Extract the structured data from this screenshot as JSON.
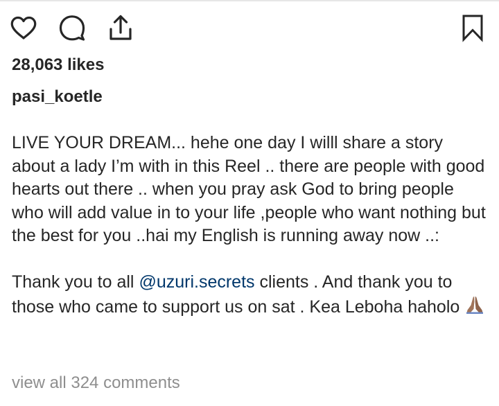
{
  "post": {
    "likes_text": "28,063 likes",
    "username": "pasi_koetle",
    "caption": {
      "para1": "LIVE YOUR DREAM... hehe one day I willl share a story about a lady I’m with in this Reel .. there are people with good hearts out there .. when you pray ask God to bring people who will add value in to your life ,people who want nothing but the best for you ..hai my English is running away now ..:",
      "para2_before_mention": "Thank you to all ",
      "mention": "@uzuri.secrets",
      "para2_after_mention": " clients . And thank you to those who came to support us on sat . Kea Leboha haholo ",
      "emoji": "praying-hands-emoji"
    },
    "view_all_comments": "view all 324 comments"
  },
  "icons": {
    "like": "heart-icon",
    "comment": "comment-bubble-icon",
    "share": "share-upload-icon",
    "save": "bookmark-icon"
  },
  "colors": {
    "text": "#262626",
    "muted": "#8e8e8e",
    "mention": "#00376b",
    "emoji_skin": "#a0745a"
  }
}
